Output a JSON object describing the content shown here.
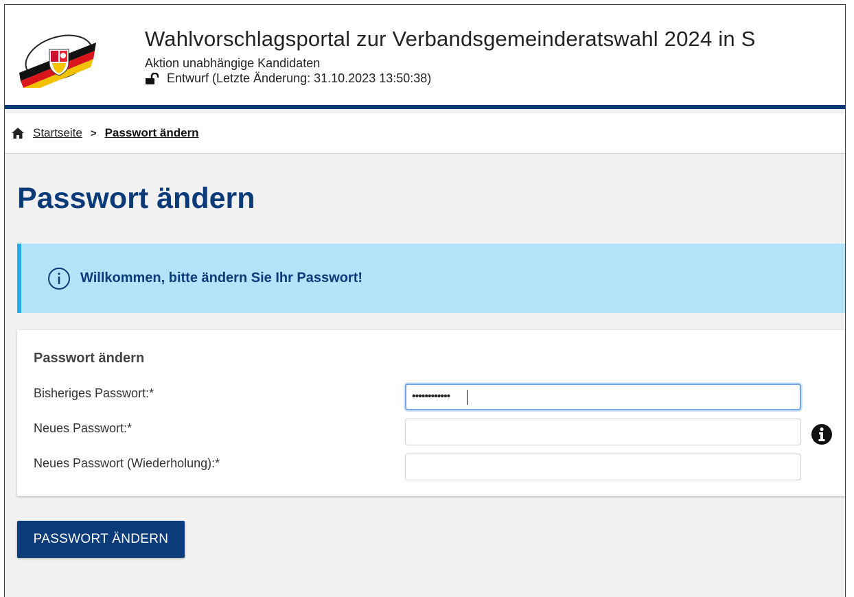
{
  "header": {
    "title": "Wahlvorschlagsportal zur Verbandsgemeinderatswahl 2024 in S",
    "subtitle": "Aktion unabhängige Kandidaten",
    "status": "Entwurf (Letzte Änderung: 31.10.2023 13:50:38)",
    "status_icon": "unlock-icon",
    "logo": "rlp-state-logo"
  },
  "breadcrumb": {
    "home_icon": "home-icon",
    "home_label": "Startseite",
    "separator": ">",
    "current_label": "Passwort ändern"
  },
  "page": {
    "title": "Passwort ändern"
  },
  "alert": {
    "icon": "info-circle-icon",
    "text": "Willkommen, bitte ändern Sie Ihr Passwort!",
    "background": "#b3e3f8",
    "border_color": "#29a9e8"
  },
  "form": {
    "title": "Passwort ändern",
    "fields": [
      {
        "label": "Bisheriges Passwort:*",
        "value": "••••••••••••",
        "focused": true
      },
      {
        "label": "Neues Passwort:*",
        "value": "",
        "help_icon": "info-icon"
      },
      {
        "label": "Neues Passwort (Wiederholung):*",
        "value": ""
      }
    ],
    "submit_label": "PASSWORT ÄNDERN"
  },
  "colors": {
    "brand": "#0c3b7a",
    "page_background": "#f1f1f1"
  }
}
